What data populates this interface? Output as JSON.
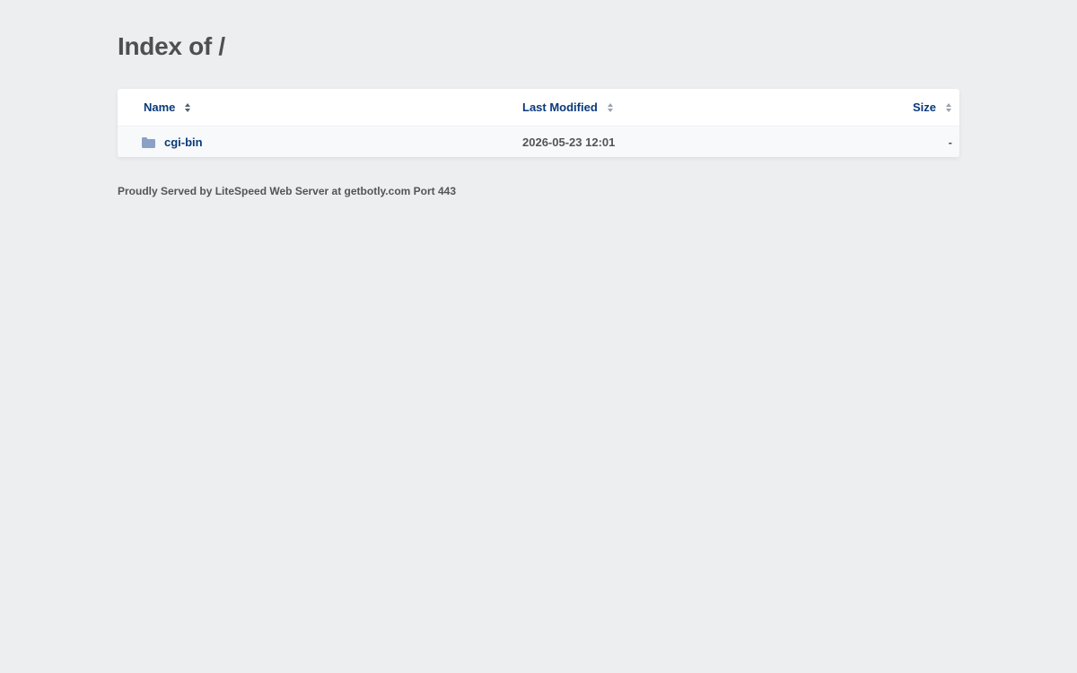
{
  "page": {
    "title": "Index of /"
  },
  "table": {
    "headers": {
      "name": "Name",
      "last_modified": "Last Modified",
      "size": "Size"
    },
    "sort_icon": "sort-arrows-icon",
    "rows": [
      {
        "icon": "folder-icon",
        "name": "cgi-bin",
        "last_modified": "2026-05-23 12:01",
        "size": "-"
      }
    ]
  },
  "footer": {
    "text": "Proudly Served by LiteSpeed Web Server at getbotly.com Port 443"
  },
  "colors": {
    "background": "#eceef0",
    "link": "#0a3a7a",
    "folder_icon": "#8aa1c4",
    "text": "#4f4f4f"
  }
}
